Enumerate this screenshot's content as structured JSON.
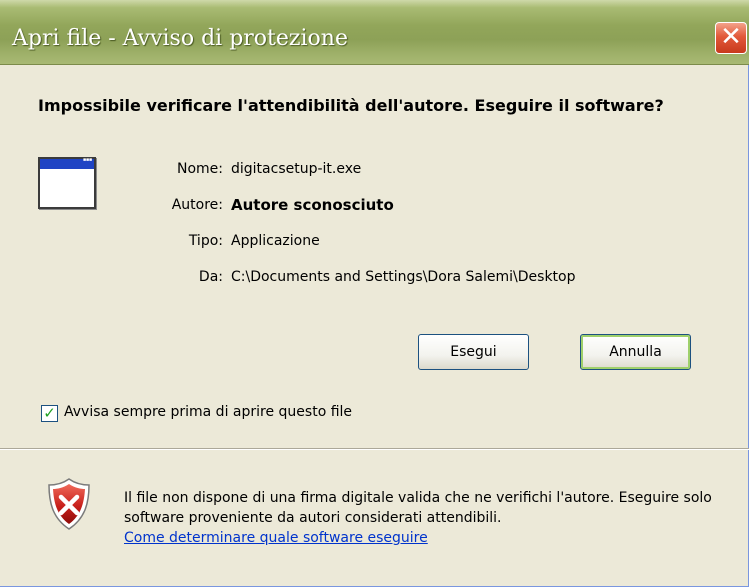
{
  "window": {
    "title": "Apri file - Avviso di protezione",
    "close_symbol": "✕"
  },
  "heading": "Impossibile verificare l'attendibilità dell'autore. Eseguire il software?",
  "file_icon": "application-window-icon",
  "fields": [
    {
      "label": "Nome:",
      "value": "digitacsetup-it.exe"
    },
    {
      "label": "Autore:",
      "value": "Autore sconosciuto"
    },
    {
      "label": "Tipo:",
      "value": "Applicazione"
    },
    {
      "label": "Da:",
      "value": "C:\\Documents and Settings\\Dora Salemi\\Desktop"
    }
  ],
  "buttons": {
    "run": "Esegui",
    "cancel": "Annulla"
  },
  "checkbox": {
    "checked": true,
    "label": "Avvisa sempre prima di aprire questo file"
  },
  "warning": {
    "icon": "shield-error-icon",
    "text": "Il file non dispone di una firma digitale valida che ne verifichi l'autore. Eseguire solo software proveniente da autori considerati attendibili.",
    "link": "Come determinare quale software eseguire"
  },
  "colors": {
    "titlebar": "#92a65a",
    "dialog_bg": "#ece9d8",
    "link": "#0033cc",
    "close_button": "#e2593a"
  }
}
